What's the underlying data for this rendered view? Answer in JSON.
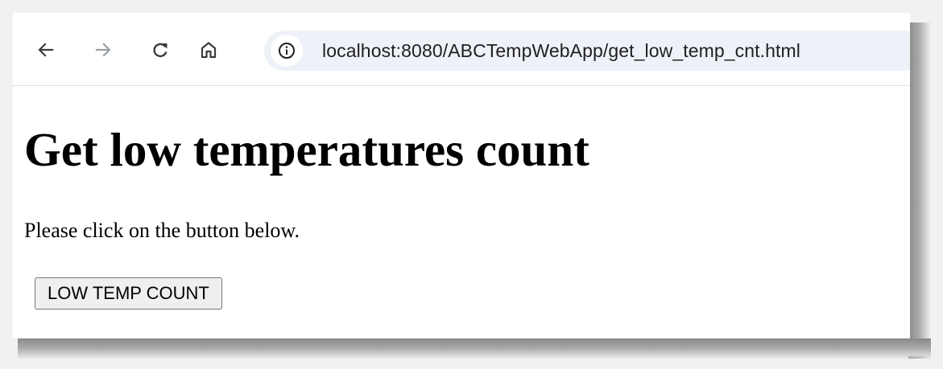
{
  "browser": {
    "toolbar": {
      "back_icon": "arrow-left-icon",
      "forward_icon": "arrow-right-icon",
      "reload_icon": "reload-icon",
      "home_icon": "home-icon",
      "forward_enabled": false
    },
    "address_bar": {
      "site_info_icon": "info-circle-icon",
      "url": "localhost:8080/ABCTempWebApp/get_low_temp_cnt.html"
    }
  },
  "page": {
    "title": "Get low temperatures count",
    "instructions": "Please click on the button below.",
    "button_label": "LOW TEMP COUNT"
  },
  "colors": {
    "toolbar_bg": "#ffffff",
    "omnibox_bg": "#eef1f8",
    "icon_active": "#3c3c3c",
    "icon_disabled": "#9aa0a6",
    "button_bg": "#efefef",
    "button_border": "#767676"
  }
}
